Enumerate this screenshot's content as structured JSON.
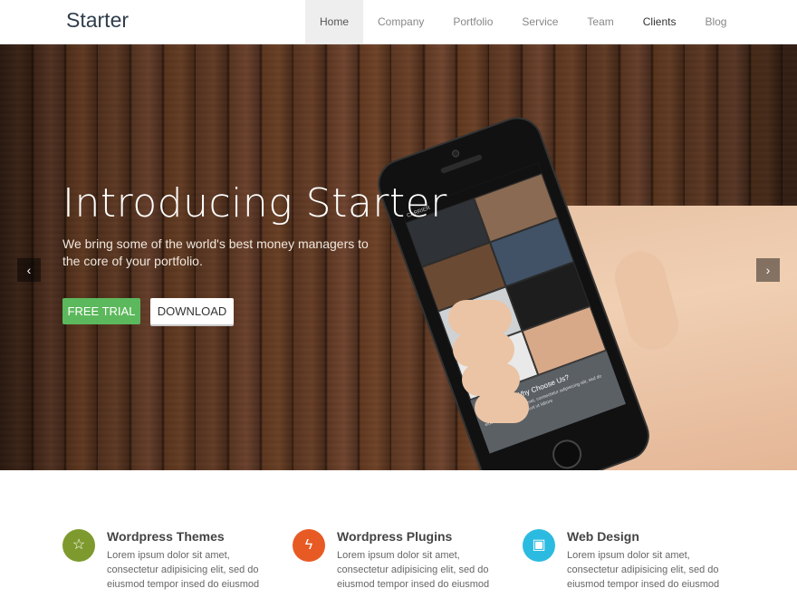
{
  "header": {
    "logo": "Starter",
    "nav": [
      "Home",
      "Company",
      "Portfolio",
      "Service",
      "Team",
      "Clients",
      "Blog"
    ],
    "active_nav": "Home"
  },
  "hero": {
    "title": "Introducing Starter",
    "subtitle": "We bring some of the world's best money managers to the core of your portfolio.",
    "buttons": {
      "trial": "FREE TRIAL",
      "download": "DOWNLOAD"
    },
    "arrows": {
      "prev": "‹",
      "next": "›"
    },
    "phone": {
      "carrier": "CARRIER",
      "screen_title": "Why Choose Us?",
      "screen_text": "Lorem ipsum dolor sit amet, consectetur adipisicing elit, sed do eiusmod tempor incididunt ut labore"
    }
  },
  "features": [
    {
      "title": "Wordpress Themes",
      "text": "Lorem ipsum dolor sit amet, consectetur adipisicing elit, sed do eiusmod tempor insed do eiusmod",
      "icon": "star-icon",
      "color": "#7e9a2e"
    },
    {
      "title": "Wordpress Plugins",
      "text": "Lorem ipsum dolor sit amet, consectetur adipisicing elit, sed do eiusmod tempor insed do eiusmod",
      "icon": "bolt-icon",
      "color": "#e85a24"
    },
    {
      "title": "Web Design",
      "text": "Lorem ipsum dolor sit amet, consectetur adipisicing elit, sed do eiusmod tempor insed do eiusmod",
      "icon": "gift-icon",
      "color": "#2cbbe0"
    }
  ],
  "colors": {
    "accent_green": "#5cb85c",
    "logo": "#2f3d4c"
  }
}
